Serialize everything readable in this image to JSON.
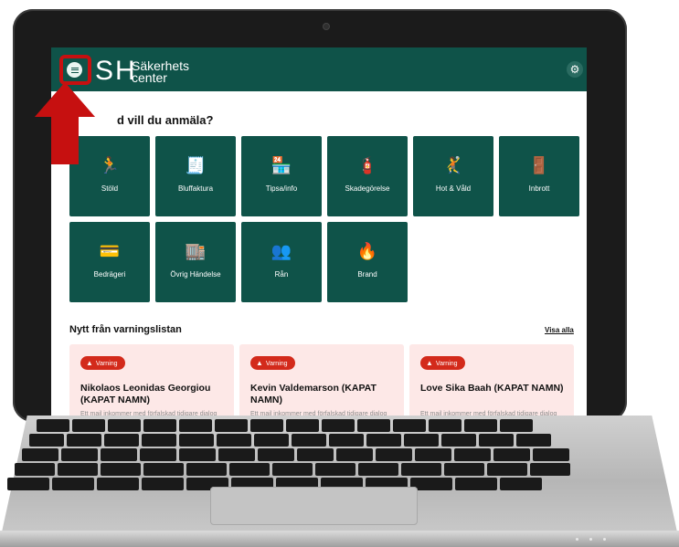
{
  "app": {
    "logo_mark": "SH",
    "logo_line1": "Säkerhets",
    "logo_line2": "center",
    "menu_icon": "hamburger-icon",
    "settings_icon": "gear-icon"
  },
  "main": {
    "heading": "d vill du anmäla?",
    "tiles": [
      {
        "label": "Stöld",
        "icon": "running-thief-icon"
      },
      {
        "label": "Bluffaktura",
        "icon": "receipt-icon"
      },
      {
        "label": "Tipsa/info",
        "icon": "storefront-icon"
      },
      {
        "label": "Skadegörelse",
        "icon": "spray-can-icon"
      },
      {
        "label": "Hot & Våld",
        "icon": "threat-icon"
      },
      {
        "label": "Inbrott",
        "icon": "door-break-in-icon"
      },
      {
        "label": "Bedrägeri",
        "icon": "card-fraud-icon"
      },
      {
        "label": "Övrig Händelse",
        "icon": "store-icon"
      },
      {
        "label": "Rån",
        "icon": "robbery-icon"
      },
      {
        "label": "Brand",
        "icon": "fire-icon"
      }
    ]
  },
  "warnings": {
    "title": "Nytt från varningslistan",
    "see_all": "Visa alla",
    "cards": [
      {
        "badge": "Varning",
        "name": "Nikolaos Leonidas Georgiou (KAPAT NAMN)",
        "text": "Ett mail inkommer med förfalskad tidigare dialog"
      },
      {
        "badge": "Varning",
        "name": "Kevin Valdemarson (KAPAT NAMN)",
        "text": "Ett mail inkommer med förfalskad tidigare dialog"
      },
      {
        "badge": "Varning",
        "name": "Love Sika Baah (KAPAT NAMN)",
        "text": "Ett mail inkommer med förfalskad tidigare dialog där den ena parten ser ut att vara någon från ditt"
      }
    ]
  },
  "colors": {
    "brand": "#0f5349",
    "warning": "#d32a1b",
    "card_bg": "#fde8e7",
    "highlight": "#c61010"
  }
}
